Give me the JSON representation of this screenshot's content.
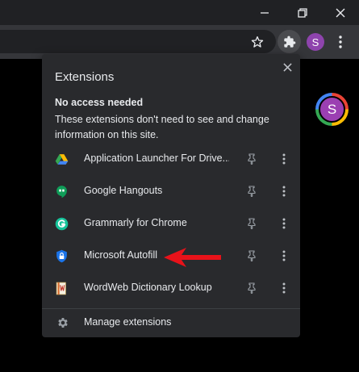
{
  "window": {
    "profile_initial": "S"
  },
  "popup": {
    "title": "Extensions",
    "section_heading": "No access needed",
    "section_description": "These extensions don't need to see and change information on this site.",
    "extensions": [
      {
        "label": "Application Launcher For Drive...",
        "icon": "google-drive-icon"
      },
      {
        "label": "Google Hangouts",
        "icon": "hangouts-icon"
      },
      {
        "label": "Grammarly for Chrome",
        "icon": "grammarly-icon"
      },
      {
        "label": "Microsoft Autofill",
        "icon": "microsoft-autofill-icon"
      },
      {
        "label": "WordWeb Dictionary Lookup",
        "icon": "wordweb-icon"
      }
    ],
    "manage_label": "Manage extensions"
  },
  "colors": {
    "popup_bg": "#292a2d",
    "toolbar_bg": "#35363a",
    "titlebar_bg": "#202124",
    "arrow": "#e8121a",
    "avatar": "#8e44ad"
  }
}
